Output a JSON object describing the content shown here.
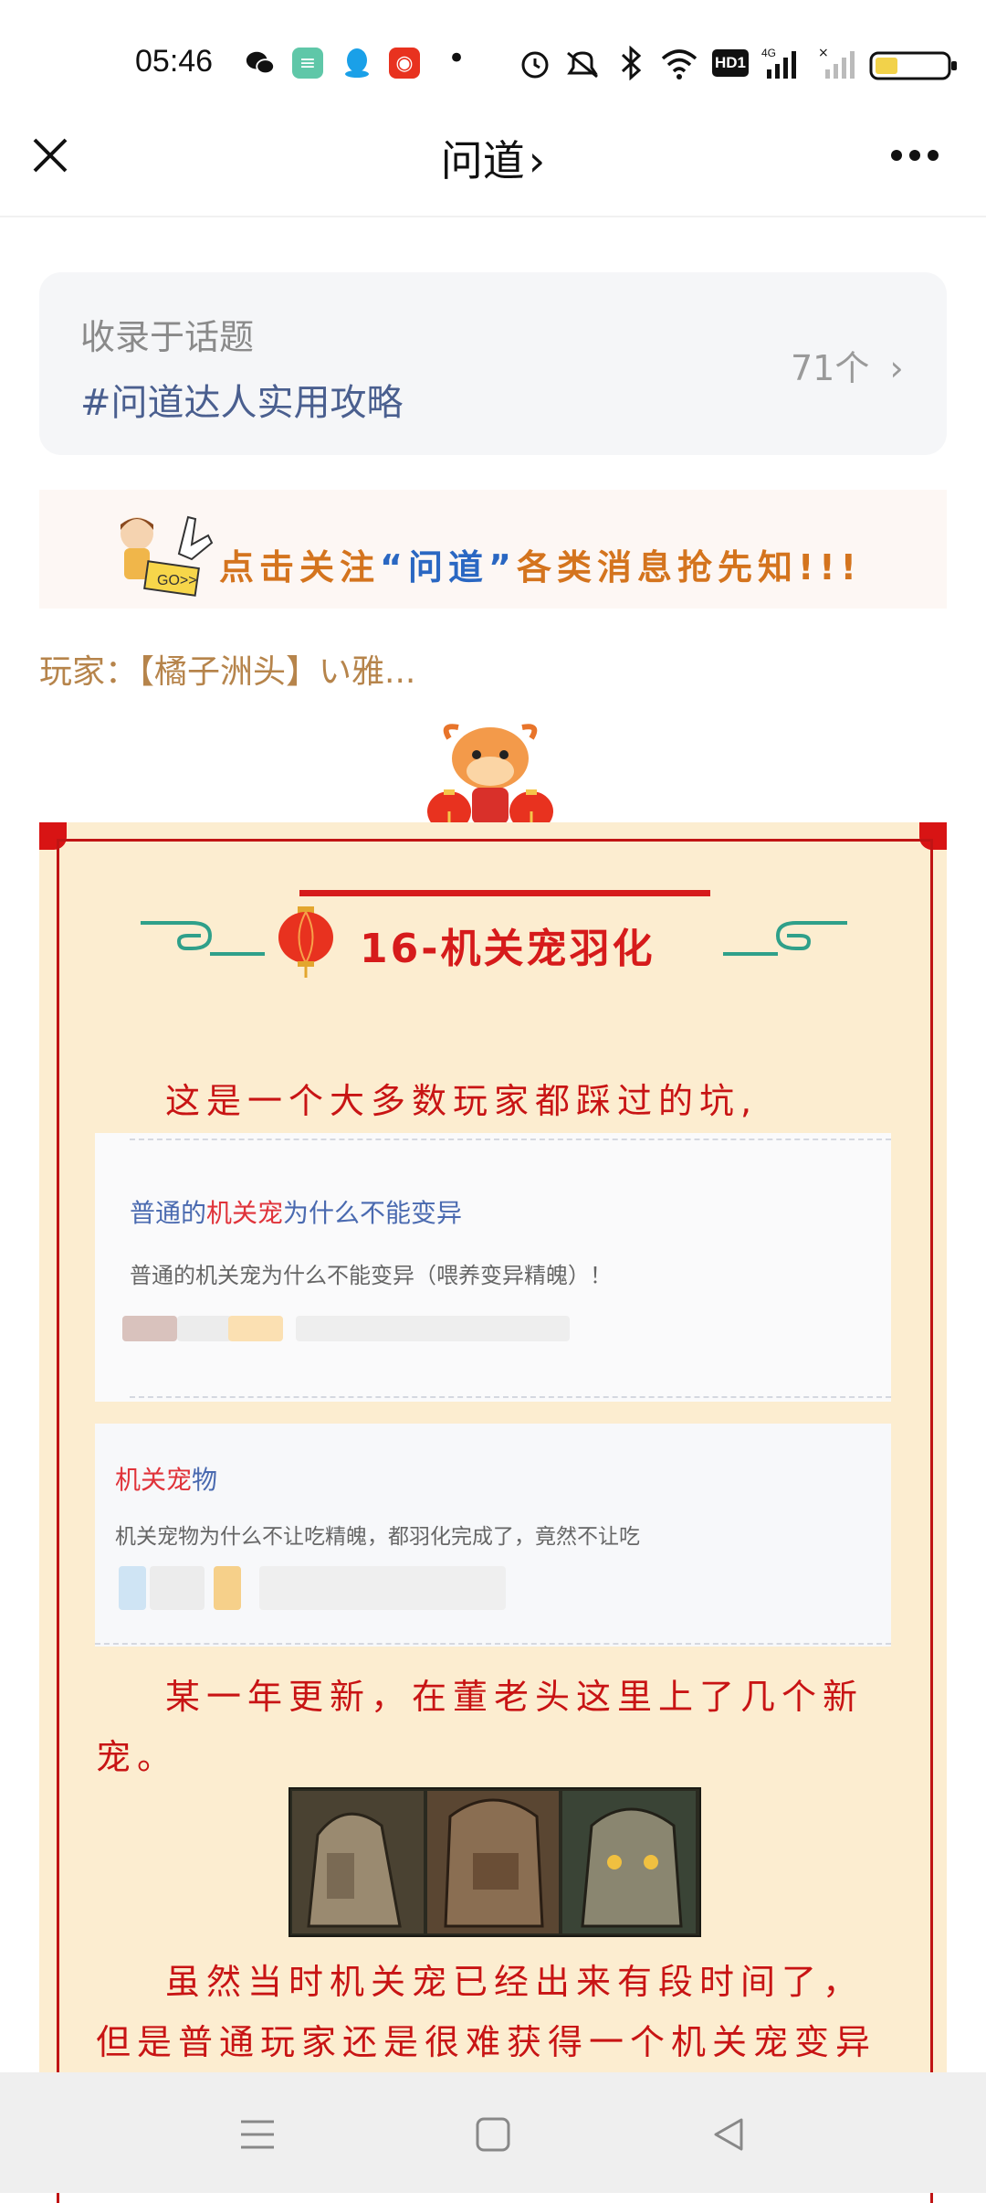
{
  "status_bar": {
    "time": "05:46",
    "dot": "•",
    "icons": [
      "wechat-icon",
      "app-icon",
      "qq-icon",
      "video-app-icon",
      "alarm-icon",
      "mute-icon",
      "bluetooth-icon",
      "wifi-icon",
      "hd-icon",
      "signal-4g-icon",
      "signal-x-icon",
      "battery-icon"
    ],
    "hd_label": "HD1",
    "net_label": "4G"
  },
  "nav": {
    "title": "问道",
    "title_chevron": "›"
  },
  "topic": {
    "caption": "收录于话题",
    "name": "#问道达人实用攻略",
    "count": "71个",
    "chevron": "›"
  },
  "banner": {
    "text_prefix": "点击关注",
    "text_highlight": "“问道”",
    "text_suffix": "各类消息抢先知!!!",
    "go_label": "GO>>"
  },
  "player_line": "玩家：【橘子洲头】い雅...",
  "article": {
    "heading": "16-机关宠羽化",
    "para1": "这是一个大多数玩家都踩过的坑,",
    "card1": {
      "title_prefix": "普通的",
      "title_highlight": "机关宠",
      "title_suffix": "为什么不能变异",
      "desc": "普通的机关宠为什么不能变异（喂养变异精魄）！"
    },
    "card2": {
      "title_highlight": "机关宠",
      "title_suffix": "物",
      "desc": "机关宠物为什么不让吃精魄，都羽化完成了，竟然不让吃"
    },
    "para2": "某一年更新，在董老头这里上了几个新宠。",
    "para3": "虽然当时机关宠已经出来有段时间了，但是普通玩家还是很难获得一个机关宠变异或者"
  },
  "bottom_nav": {
    "icons": [
      "menu-icon",
      "home-square-icon",
      "back-triangle-icon"
    ]
  }
}
